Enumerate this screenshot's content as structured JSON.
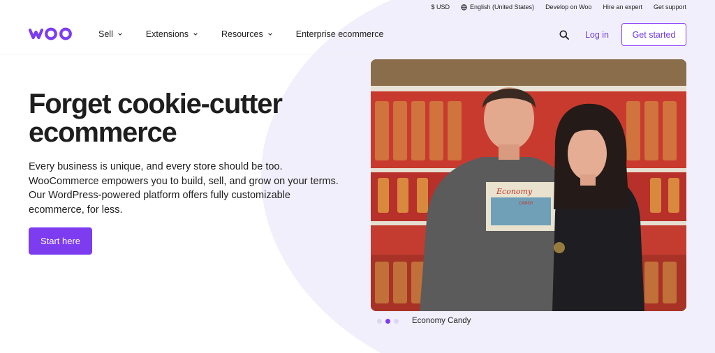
{
  "utility": {
    "currency": "$ USD",
    "language": "English (United States)",
    "develop": "Develop on Woo",
    "hire": "Hire an expert",
    "support": "Get support"
  },
  "nav": {
    "logo": "woo",
    "links": [
      "Sell",
      "Extensions",
      "Resources",
      "Enterprise ecommerce"
    ],
    "login": "Log in",
    "get_started": "Get started"
  },
  "hero": {
    "title_line1": "Forget cookie-cutter",
    "title_line2": "ecommerce",
    "description": "Every business is unique, and every store should be too. WooCommerce empowers you to build, sell, and grow on your terms. Our WordPress-powered platform offers fully customizable ecommerce, for less.",
    "cta": "Start here"
  },
  "carousel": {
    "caption": "Economy Candy",
    "slide_count": 3,
    "active_slide": 2
  },
  "photo": {
    "shirt_text_top": "Economy",
    "shirt_text_bottom": "CANDY"
  },
  "colors": {
    "brand": "#7d3cf0",
    "blob": "#f0ecfb",
    "text": "#1e1e1e"
  }
}
